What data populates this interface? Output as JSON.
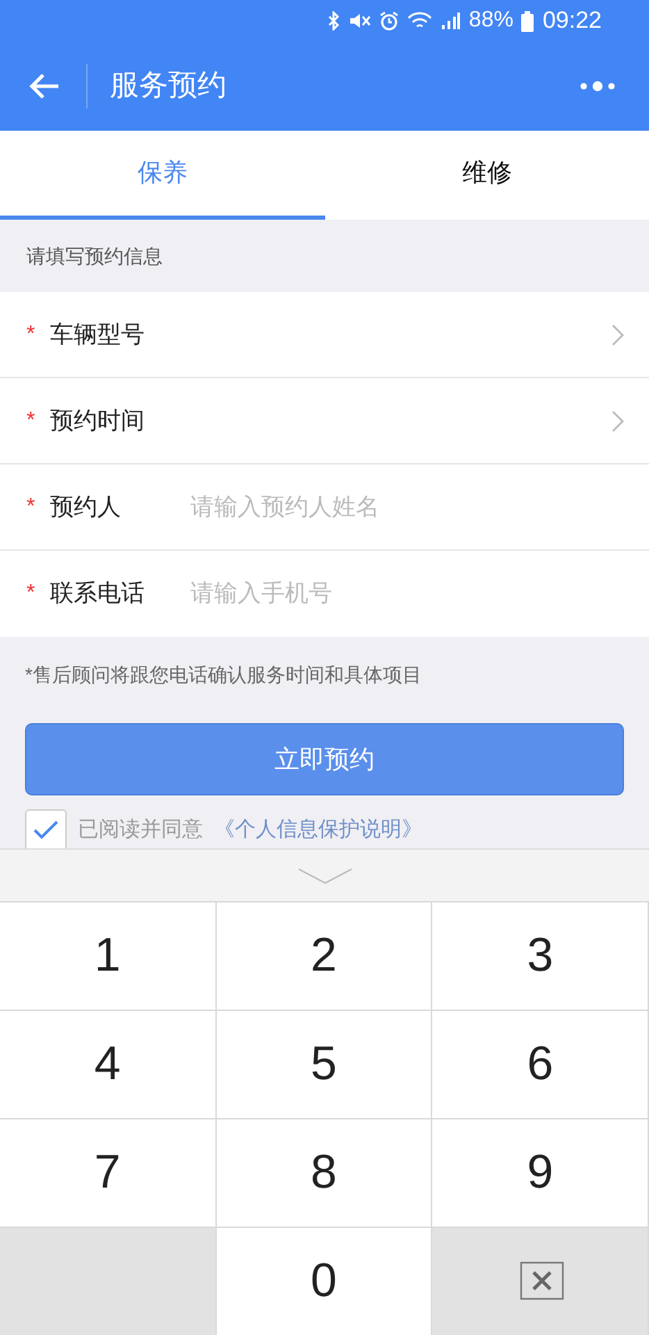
{
  "status_bar": {
    "battery": "88%",
    "time": "09:22"
  },
  "header": {
    "title": "服务预约"
  },
  "tabs": [
    {
      "label": "保养",
      "selected": true
    },
    {
      "label": "维修",
      "selected": false
    }
  ],
  "section_label": "请填写预约信息",
  "form_rows": [
    {
      "kind": "select",
      "required_mark": "*",
      "label": "车辆型号"
    },
    {
      "kind": "select",
      "required_mark": "*",
      "label": "预约时间"
    },
    {
      "kind": "input",
      "required_mark": "*",
      "label": "预约人",
      "placeholder": "请输入预约人姓名"
    },
    {
      "kind": "input",
      "required_mark": "*",
      "label": "联系电话",
      "placeholder": "请输入手机号"
    }
  ],
  "note": "*售后顾问将跟您电话确认服务时间和具体项目",
  "submit_button": "立即预约",
  "agreement": {
    "checked": true,
    "text": "已阅读并同意",
    "link": "《个人信息保护说明》"
  },
  "keypad": {
    "keys": [
      {
        "kind": "digit",
        "label": "1"
      },
      {
        "kind": "digit",
        "label": "2"
      },
      {
        "kind": "digit",
        "label": "3"
      },
      {
        "kind": "digit",
        "label": "4"
      },
      {
        "kind": "digit",
        "label": "5"
      },
      {
        "kind": "digit",
        "label": "6"
      },
      {
        "kind": "digit",
        "label": "7"
      },
      {
        "kind": "digit",
        "label": "8"
      },
      {
        "kind": "digit",
        "label": "9"
      },
      {
        "kind": "blank"
      },
      {
        "kind": "digit",
        "label": "0"
      },
      {
        "kind": "delete"
      }
    ]
  }
}
